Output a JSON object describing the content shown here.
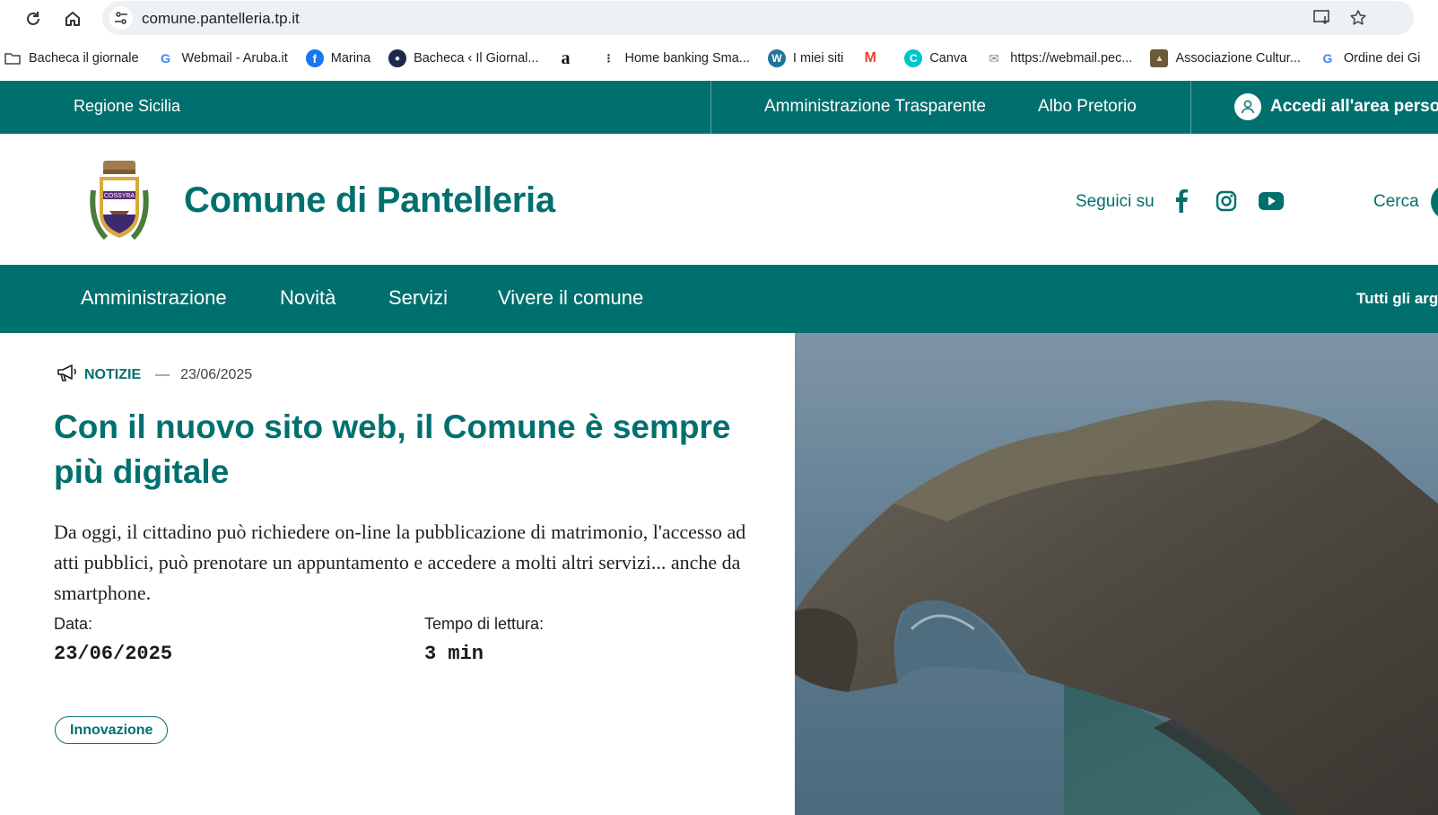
{
  "browser": {
    "url": "comune.pantelleria.tp.it",
    "bookmarks": [
      {
        "label": "Bacheca il giornale",
        "icon": "folder-icon"
      },
      {
        "label": "Webmail - Aruba.it",
        "icon": "google-icon"
      },
      {
        "label": "Marina",
        "icon": "facebook-icon"
      },
      {
        "label": "Bacheca ‹ Il Giornal...",
        "icon": "bookmark-site-icon"
      },
      {
        "label": "",
        "icon": "amazon-icon"
      },
      {
        "label": "Home banking Sma...",
        "icon": "dots-icon"
      },
      {
        "label": "I miei siti",
        "icon": "wordpress-icon"
      },
      {
        "label": "",
        "icon": "gmail-icon"
      },
      {
        "label": "Canva",
        "icon": "canva-icon"
      },
      {
        "label": "https://webmail.pec...",
        "icon": "pec-icon"
      },
      {
        "label": "Associazione Cultur...",
        "icon": "association-icon"
      },
      {
        "label": "Ordine dei Gi",
        "icon": "google-icon"
      }
    ]
  },
  "top_bar": {
    "region": "Regione Sicilia",
    "links": [
      "Amministrazione Trasparente",
      "Albo Pretorio"
    ],
    "login": "Accedi all'area personale"
  },
  "header": {
    "title": "Comune di Pantelleria",
    "crest_text": "COSSYRA",
    "follow": "Seguici su",
    "search": "Cerca"
  },
  "nav": {
    "items": [
      "Amministrazione",
      "Novità",
      "Servizi",
      "Vivere il comune"
    ],
    "topics": "Tutti gli argomenti"
  },
  "article": {
    "category": "NOTIZIE",
    "date_meta": "23/06/2025",
    "title": "Con il nuovo sito web, il Comune è sempre più digitale",
    "lead": "Da oggi, il cittadino può richiedere on-line la pubblicazione di matrimonio, l'accesso ad atti pubblici, può prenotare un appuntamento e accedere a molti altri servizi... anche da smartphone.",
    "date_label": "Data:",
    "date_value": "23/06/2025",
    "reading_label": "Tempo di lettura:",
    "reading_value": "3 min",
    "tag": "Innovazione"
  },
  "colors": {
    "brand": "#00706e",
    "omnibox": "#eef1f4"
  }
}
